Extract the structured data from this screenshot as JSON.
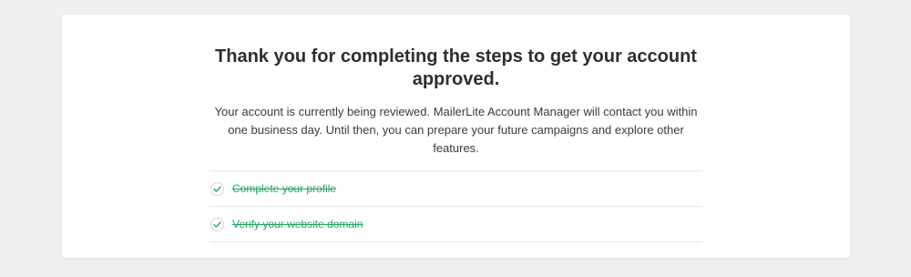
{
  "confirmation": {
    "title": "Thank you for completing the steps to get your account approved.",
    "description": "Your account is currently being reviewed. MailerLite Account Manager will contact you within one business day. Until then, you can prepare your future campaigns and explore other features."
  },
  "steps": [
    {
      "label": "Complete your profile",
      "completed": true,
      "icon": "check-icon"
    },
    {
      "label": "Verify your website domain",
      "completed": true,
      "icon": "check-icon"
    }
  ],
  "colors": {
    "accent": "#22a65f",
    "page_background": "#efefef",
    "card_background": "#ffffff",
    "title_text": "#2e2e2e"
  }
}
